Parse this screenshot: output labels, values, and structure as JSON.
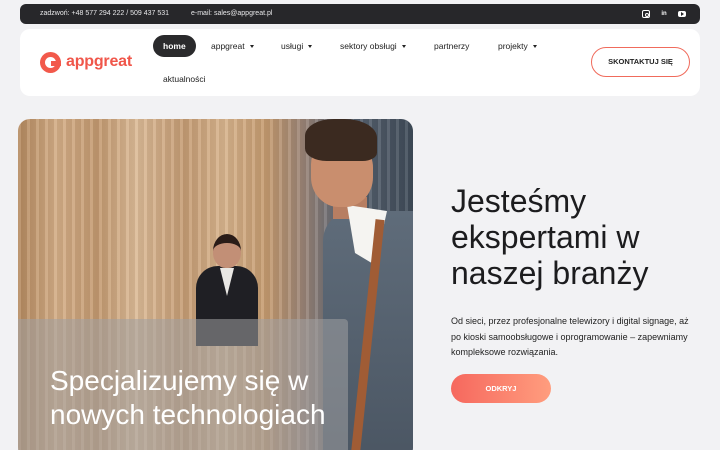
{
  "topbar": {
    "phone": "zadzwoń: +48 577 294 222 / 509 437 531",
    "email": "e-mail: sales@appgreat.pl",
    "socials": [
      {
        "icon": "instagram-icon"
      },
      {
        "icon": "linkedin-icon",
        "glyph": "in"
      },
      {
        "icon": "youtube-icon"
      }
    ]
  },
  "logo": {
    "text": "appgreat",
    "color": "#f0564a"
  },
  "nav": {
    "items": [
      {
        "label": "home",
        "active": true
      },
      {
        "label": "appgreat",
        "dropdown": true
      },
      {
        "label": "usługi",
        "dropdown": true
      },
      {
        "label": "sektory obsługi",
        "dropdown": true
      },
      {
        "label": "partnerzy"
      },
      {
        "label": "projekty",
        "dropdown": true
      },
      {
        "label": "aktualności"
      }
    ],
    "cta": "SKONTAKTUJ SIĘ"
  },
  "hero": {
    "image_caption": "Specjalizujemy się w nowych technologiach",
    "headline": "Jesteśmy ekspertami w naszej branży",
    "description": "Od sieci, przez profesjonalne telewizory i digital signage, aż po kioski samoobsługowe i oprogramowanie – zapewniamy kompleksowe rozwiązania.",
    "button": "ODKRYJ"
  },
  "colors": {
    "accent": "#f2594b",
    "topbar_bg": "#27272a",
    "page_bg": "#f2f2f4"
  }
}
